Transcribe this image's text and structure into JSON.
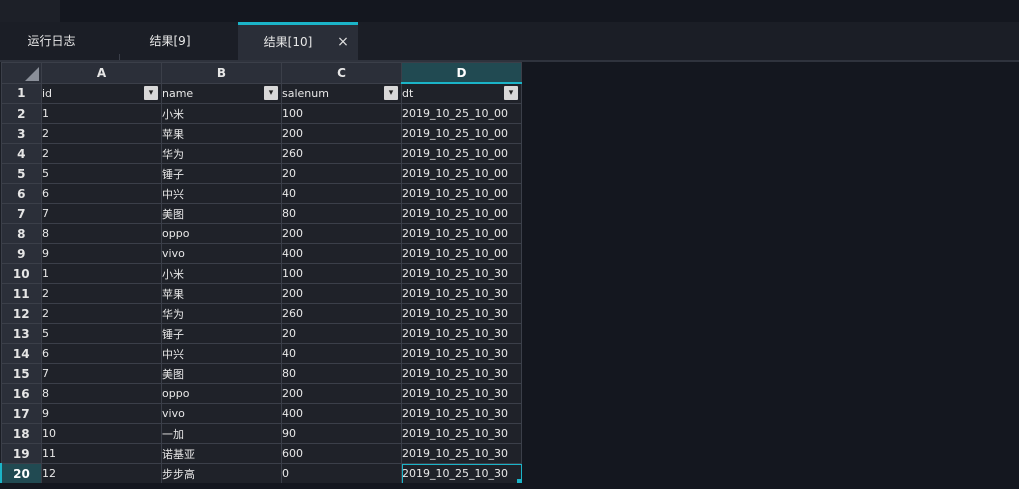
{
  "tabs": [
    {
      "label": "运行日志"
    },
    {
      "label": "结果[9]"
    },
    {
      "label": "结果[10]"
    }
  ],
  "close_glyph": "×",
  "columns": [
    "A",
    "B",
    "C",
    "D"
  ],
  "header_row": {
    "num": "1",
    "cells": [
      "id",
      "name",
      "salenum",
      "dt"
    ]
  },
  "rows": [
    {
      "num": "2",
      "cells": [
        "1",
        "小米",
        "100",
        "2019_10_25_10_00"
      ]
    },
    {
      "num": "3",
      "cells": [
        "2",
        "苹果",
        "200",
        "2019_10_25_10_00"
      ]
    },
    {
      "num": "4",
      "cells": [
        "2",
        "华为",
        "260",
        "2019_10_25_10_00"
      ]
    },
    {
      "num": "5",
      "cells": [
        "5",
        "锤子",
        "20",
        "2019_10_25_10_00"
      ]
    },
    {
      "num": "6",
      "cells": [
        "6",
        "中兴",
        "40",
        "2019_10_25_10_00"
      ]
    },
    {
      "num": "7",
      "cells": [
        "7",
        "美图",
        "80",
        "2019_10_25_10_00"
      ]
    },
    {
      "num": "8",
      "cells": [
        "8",
        "oppo",
        "200",
        "2019_10_25_10_00"
      ]
    },
    {
      "num": "9",
      "cells": [
        "9",
        "vivo",
        "400",
        "2019_10_25_10_00"
      ]
    },
    {
      "num": "10",
      "cells": [
        "1",
        "小米",
        "100",
        "2019_10_25_10_30"
      ]
    },
    {
      "num": "11",
      "cells": [
        "2",
        "苹果",
        "200",
        "2019_10_25_10_30"
      ]
    },
    {
      "num": "12",
      "cells": [
        "2",
        "华为",
        "260",
        "2019_10_25_10_30"
      ]
    },
    {
      "num": "13",
      "cells": [
        "5",
        "锤子",
        "20",
        "2019_10_25_10_30"
      ]
    },
    {
      "num": "14",
      "cells": [
        "6",
        "中兴",
        "40",
        "2019_10_25_10_30"
      ]
    },
    {
      "num": "15",
      "cells": [
        "7",
        "美图",
        "80",
        "2019_10_25_10_30"
      ]
    },
    {
      "num": "16",
      "cells": [
        "8",
        "oppo",
        "200",
        "2019_10_25_10_30"
      ]
    },
    {
      "num": "17",
      "cells": [
        "9",
        "vivo",
        "400",
        "2019_10_25_10_30"
      ]
    },
    {
      "num": "18",
      "cells": [
        "10",
        "一加",
        "90",
        "2019_10_25_10_30"
      ]
    },
    {
      "num": "19",
      "cells": [
        "11",
        "诺基亚",
        "600",
        "2019_10_25_10_30"
      ]
    },
    {
      "num": "20",
      "cells": [
        "12",
        "步步高",
        "0",
        "2019_10_25_10_30"
      ]
    }
  ],
  "selected": {
    "row": "20",
    "col": "D"
  },
  "colors": {
    "accent": "#1bb4c8",
    "background": "#14171f",
    "cell": "#1f2229",
    "header": "#2b2f39",
    "active_header": "#214a52"
  }
}
